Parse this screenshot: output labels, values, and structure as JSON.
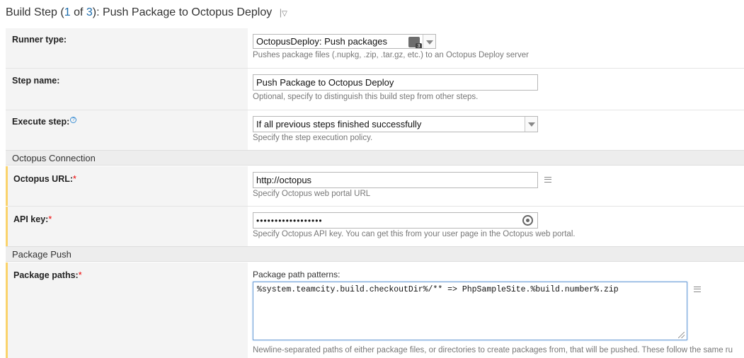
{
  "page": {
    "title_prefix": "Build Step (",
    "step_current": "1",
    "step_of": " of ",
    "step_total": "3",
    "title_suffix": "): Push Package to Octopus Deploy",
    "title_separator": "|",
    "title_menu": "▽"
  },
  "runner": {
    "label": "Runner type:",
    "value": "OctopusDeploy: Push packages",
    "hint": "Pushes package files (.nupkg, .zip, .tar.gz, etc.) to an Octopus Deploy server"
  },
  "step_name": {
    "label": "Step name:",
    "value": "Push Package to Octopus Deploy",
    "hint": "Optional, specify to distinguish this build step from other steps."
  },
  "execute_step": {
    "label": "Execute step:",
    "help": "?",
    "value": "If all previous steps finished successfully",
    "hint": "Specify the step execution policy."
  },
  "section_connection": {
    "title": "Octopus Connection"
  },
  "octopus_url": {
    "label": "Octopus URL:",
    "required": "*",
    "value": "http://octopus",
    "hint": "Specify Octopus web portal URL"
  },
  "api_key": {
    "label": "API key:",
    "required": "*",
    "value": "••••••••••••••••••",
    "hint": "Specify Octopus API key. You can get this from your user page in the Octopus web portal."
  },
  "section_push": {
    "title": "Package Push"
  },
  "package_paths": {
    "label": "Package paths:",
    "required": "*",
    "field_caption": "Package path patterns:",
    "value": "%system.teamcity.build.checkoutDir%/** => PhpSampleSite.%build.number%.zip",
    "hint": "Newline-separated paths of either package files, or directories to create packages from, that will be pushed. These follow the same ru"
  },
  "icons": {
    "teamcity_runner": "teamcity-runner-icon",
    "parameters": "parameters-list-icon",
    "show_password": "show-password-icon",
    "help": "help-icon"
  },
  "colors": {
    "required_marker": "#fad36c",
    "section_bg": "#ededed",
    "link_number": "#1a6aab"
  }
}
